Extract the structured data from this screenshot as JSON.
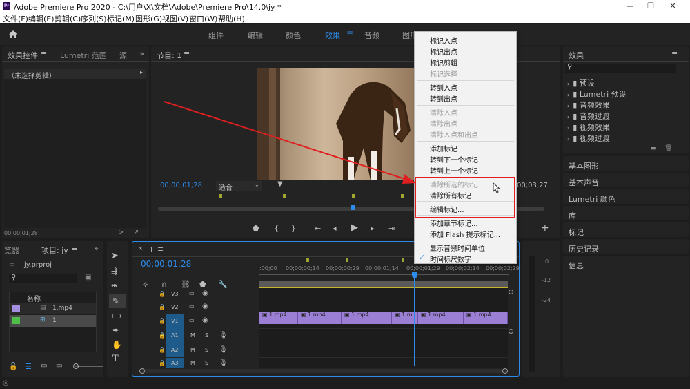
{
  "window": {
    "app_icon_text": "Pr",
    "title": "Adobe Premiere Pro 2020 - C:\\用户\\X\\文档\\Adobe\\Premiere Pro\\14.0\\jy *",
    "minimize": "—",
    "restore": "❐",
    "close": "✕"
  },
  "menubar": [
    "文件(F)",
    "编辑(E)",
    "剪辑(C)",
    "序列(S)",
    "标记(M)",
    "图形(G)",
    "视图(V)",
    "窗口(W)",
    "帮助(H)"
  ],
  "workspaces": {
    "home_icon": "home-icon",
    "tabs": [
      "组件",
      "编辑",
      "颜色",
      "效果",
      "音频",
      "图形"
    ],
    "active": "效果",
    "more": "»"
  },
  "effect_controls": {
    "tabs": [
      "效果控件",
      "Lumetri 范围",
      "源"
    ],
    "no_clip": "（未选择剪辑）",
    "timecode": "00;00;01;28"
  },
  "program": {
    "title": "节目: 1",
    "timecode_left": "00;00;01;28",
    "fit": "适合",
    "timecode_right": "00;03;27"
  },
  "project": {
    "tabs": [
      "览器",
      "项目: jy"
    ],
    "file": "jy.prproj",
    "column_name": "名称",
    "items": [
      "1.mp4",
      "1"
    ]
  },
  "timeline": {
    "title": "1",
    "timecode": "00;00;01;28",
    "ruler": [
      ":00;00",
      "00;00;00;14",
      "00;00;00;29",
      "00;00;01;14",
      "00;00;01;29",
      "00;00;02;14",
      "00;00;02;29"
    ],
    "video_tracks": [
      "V3",
      "V2",
      "V1"
    ],
    "audio_tracks": [
      "A1",
      "A2",
      "A3"
    ],
    "mute": "M",
    "solo": "S",
    "clips": [
      "1.mp4",
      "1.mp4",
      "1.mp4",
      "1.m",
      "1.mp4",
      "1.mp4"
    ]
  },
  "effects_panel": {
    "title": "效果",
    "folders": [
      "预设",
      "Lumetri 预设",
      "音频效果",
      "音频过渡",
      "视频效果",
      "视频过渡"
    ],
    "sections": [
      "基本图形",
      "基本声音",
      "Lumetri 颜色",
      "库",
      "标记",
      "历史记录",
      "信息"
    ]
  },
  "audio_meter": {
    "labels": [
      "0",
      "-12",
      "-24"
    ]
  },
  "context_menu": {
    "items": [
      {
        "label": "标记入点",
        "disabled": false
      },
      {
        "label": "标记出点",
        "disabled": false
      },
      {
        "label": "标记剪辑",
        "disabled": false
      },
      {
        "label": "标记选择",
        "disabled": true
      },
      {
        "label": "转到入点",
        "disabled": false
      },
      {
        "label": "转到出点",
        "disabled": false
      },
      {
        "label": "清除入点",
        "disabled": true
      },
      {
        "label": "清除出点",
        "disabled": true
      },
      {
        "label": "清除入点和出点",
        "disabled": true
      },
      {
        "label": "添加标记",
        "disabled": false
      },
      {
        "label": "转到下一个标记",
        "disabled": false
      },
      {
        "label": "转到上一个标记",
        "disabled": false
      },
      {
        "label": "清除所选的标记",
        "disabled": true
      },
      {
        "label": "清除所有标记",
        "disabled": false
      },
      {
        "label": "编辑标记...",
        "disabled": false
      },
      {
        "label": "添加章节标记...",
        "disabled": false
      },
      {
        "label": "添加 Flash 提示标记...",
        "disabled": false
      },
      {
        "label": "显示音频时间单位",
        "disabled": false
      },
      {
        "label": "时间标尺数字",
        "disabled": false,
        "checked": true
      }
    ],
    "check": "✓"
  },
  "colors": {
    "accent": "#2d8ceb",
    "highlight_box": "#e02020",
    "arrow": "#e02020",
    "clip": "#9b7fd4"
  }
}
